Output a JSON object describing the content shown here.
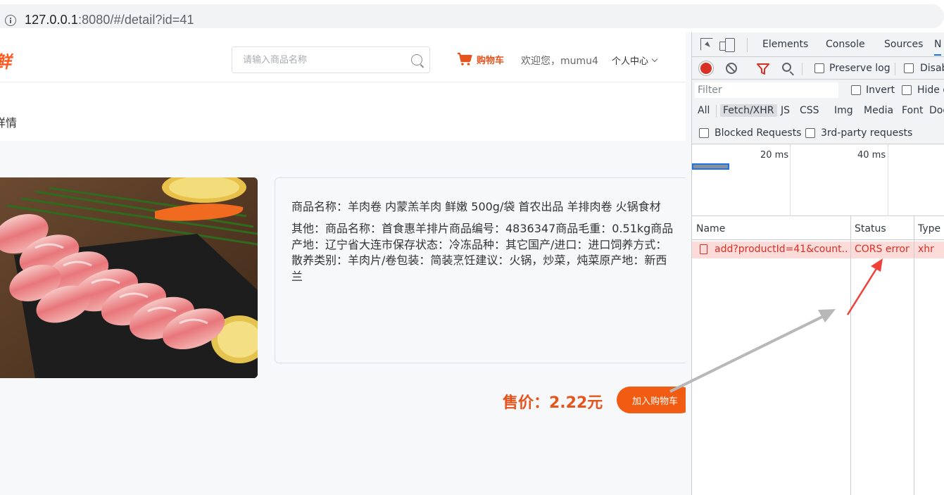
{
  "browser": {
    "url_host": "127.0.0.1",
    "url_rest": ":8080/#/detail?id=41"
  },
  "site": {
    "logo_text": "鲜",
    "search": {
      "placeholder": "请输入商品名称"
    },
    "cart_label": "购物车",
    "welcome": "欢迎您，mumu4",
    "user_menu": "个人中心",
    "breadcrumb": "详情",
    "product": {
      "name": "商品名称：羊肉卷 内蒙羔羊肉 鲜嫩 500g/袋 首农出品 羊排肉卷 火锅食材",
      "other": "其他：商品名称：首食惠羊排片商品编号：4836347商品毛重：0.51kg商品产地：辽宁省大连市保存状态：冷冻品种：其它国产/进口：进口饲养方式：散养类别：羊肉片/卷包装：简装烹饪建议：火锅，炒菜，炖菜原产地：新西兰",
      "price": "售价：2.22元",
      "add_to_cart": "加入购物车"
    },
    "colors": {
      "accent": "#f25b12",
      "price": "#e6541e"
    }
  },
  "devtools": {
    "tabs": [
      "Elements",
      "Console",
      "Sources",
      "N"
    ],
    "active_tab": "N",
    "toolbar": {
      "preserve_log": "Preserve log",
      "disable_cache": "Disab"
    },
    "filter": {
      "placeholder": "Filter",
      "invert": "Invert",
      "hide": "Hide d"
    },
    "types": [
      "All",
      "Fetch/XHR",
      "JS",
      "CSS",
      "Img",
      "Media",
      "Font",
      "Doc"
    ],
    "active_type": "Fetch/XHR",
    "blocked_requests": "Blocked Requests",
    "third_party": "3rd-party requests",
    "timeline": {
      "tick_1": "20 ms",
      "tick_2": "40 ms"
    },
    "table": {
      "headers": {
        "name": "Name",
        "status": "Status",
        "type": "Type"
      },
      "rows": [
        {
          "name": "add?productId=41&count...",
          "status": "CORS error",
          "type": "xhr"
        }
      ]
    },
    "colors": {
      "error": "#d93025",
      "error_row_bg": "#fddbd8",
      "record": "#d93025"
    }
  },
  "annotations": {
    "arrow_gray": "#b8b8b8",
    "arrow_red": "#f0403a"
  }
}
